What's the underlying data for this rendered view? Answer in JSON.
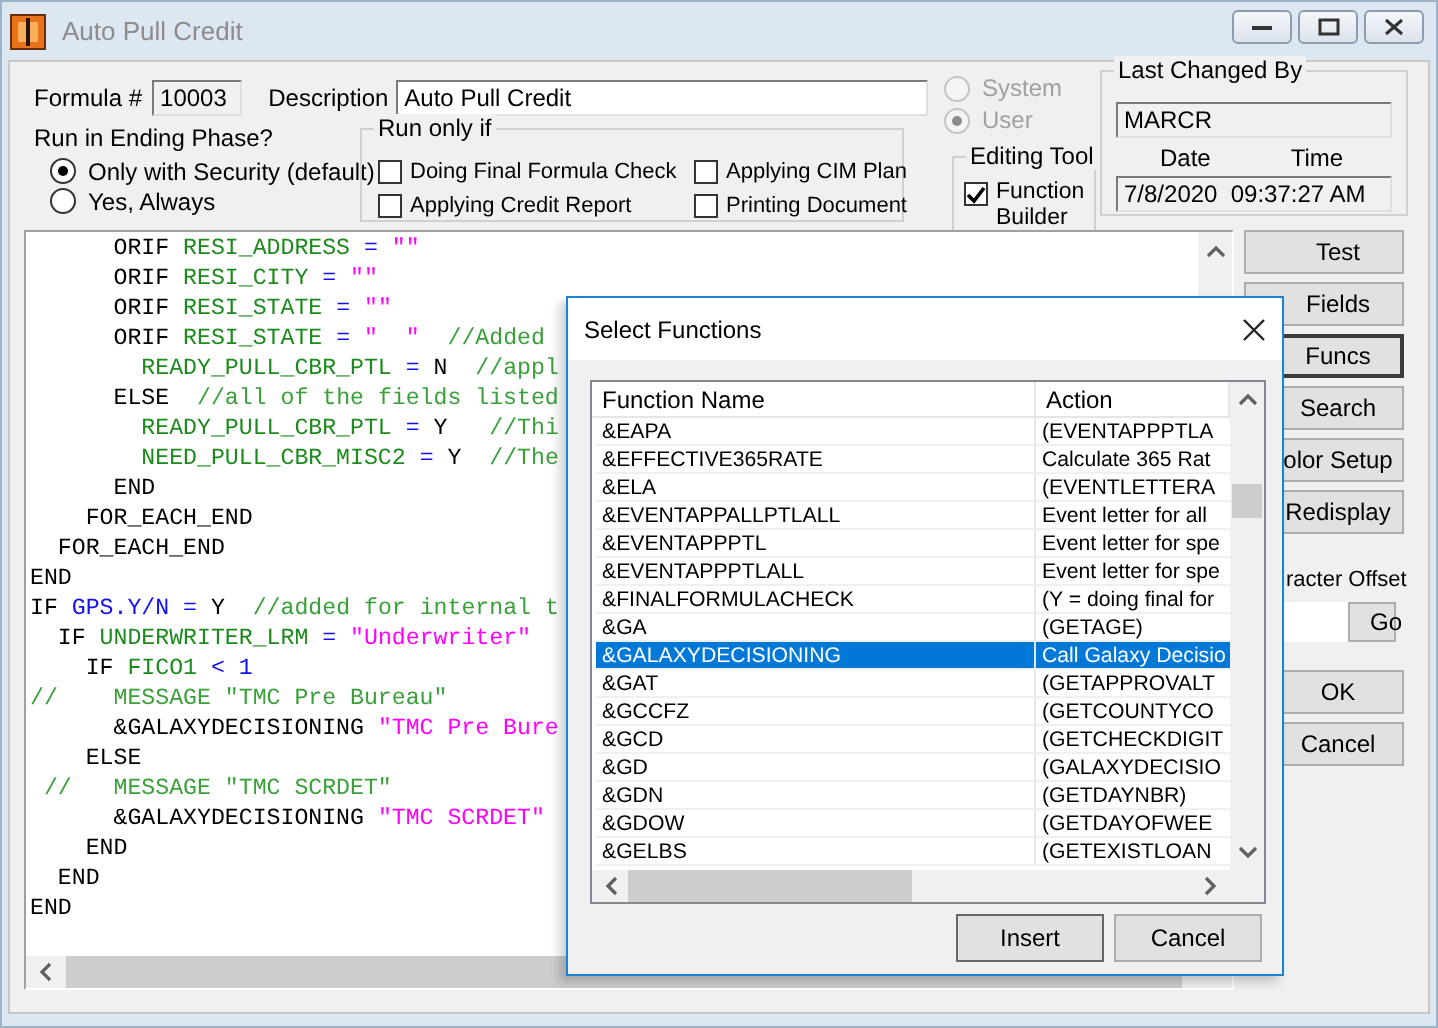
{
  "window": {
    "title": "Auto Pull Credit"
  },
  "formula": {
    "label": "Formula #",
    "value": "10003"
  },
  "description": {
    "label": "Description",
    "value": "Auto Pull Credit"
  },
  "ending_phase": {
    "label": "Run in Ending Phase?",
    "options": [
      {
        "label": "Only with Security (default)",
        "selected": true
      },
      {
        "label": "Yes, Always",
        "selected": false
      }
    ]
  },
  "run_only_if": {
    "title": "Run only if",
    "options": [
      {
        "label": "Doing Final Formula Check",
        "checked": false
      },
      {
        "label": "Applying CIM Plan",
        "checked": false
      },
      {
        "label": "Applying Credit Report",
        "checked": false
      },
      {
        "label": "Printing Document",
        "checked": false
      }
    ]
  },
  "scope": {
    "options": [
      {
        "label": "System",
        "selected": false,
        "disabled": true
      },
      {
        "label": "User",
        "selected": true,
        "disabled": true
      }
    ]
  },
  "editing_tool": {
    "title": "Editing Tool",
    "options": [
      {
        "label": "Function Builder",
        "checked": true
      }
    ]
  },
  "last_changed": {
    "title": "Last Changed By",
    "user": "MARCR",
    "date_label": "Date",
    "time_label": "Time",
    "datetime": "7/8/2020  09:37:27 AM"
  },
  "editor": {
    "lines": [
      {
        "tokens": [
          {
            "kind": "kw",
            "text": "      ORIF "
          },
          {
            "kind": "ident",
            "text": "RESI_ADDRESS"
          },
          {
            "kind": "op",
            "text": " = "
          },
          {
            "kind": "str",
            "text": "\"\""
          }
        ]
      },
      {
        "tokens": [
          {
            "kind": "kw",
            "text": "      ORIF "
          },
          {
            "kind": "ident",
            "text": "RESI_CITY"
          },
          {
            "kind": "op",
            "text": " = "
          },
          {
            "kind": "str",
            "text": "\"\""
          }
        ]
      },
      {
        "tokens": [
          {
            "kind": "kw",
            "text": "      ORIF "
          },
          {
            "kind": "ident",
            "text": "RESI_STATE"
          },
          {
            "kind": "op",
            "text": " = "
          },
          {
            "kind": "str",
            "text": "\"\""
          }
        ]
      },
      {
        "tokens": [
          {
            "kind": "kw",
            "text": "      ORIF "
          },
          {
            "kind": "ident",
            "text": "RESI_STATE"
          },
          {
            "kind": "op",
            "text": " = "
          },
          {
            "kind": "str",
            "text": "\"  \""
          },
          {
            "kind": "comment",
            "text": "  //Added"
          }
        ]
      },
      {
        "tokens": [
          {
            "kind": "ident",
            "text": "        READY_PULL_CBR_PTL"
          },
          {
            "kind": "op",
            "text": " = "
          },
          {
            "kind": "kw",
            "text": "N"
          },
          {
            "kind": "comment",
            "text": "  //appl"
          }
        ]
      },
      {
        "tokens": [
          {
            "kind": "kw",
            "text": "      ELSE"
          },
          {
            "kind": "comment",
            "text": "  //all of the fields listed"
          }
        ]
      },
      {
        "tokens": [
          {
            "kind": "ident",
            "text": "        READY_PULL_CBR_PTL"
          },
          {
            "kind": "op",
            "text": " = "
          },
          {
            "kind": "kw",
            "text": "Y"
          },
          {
            "kind": "comment",
            "text": "   //Thi"
          }
        ]
      },
      {
        "tokens": [
          {
            "kind": "ident",
            "text": "        NEED_PULL_CBR_MISC2"
          },
          {
            "kind": "op",
            "text": " = "
          },
          {
            "kind": "kw",
            "text": "Y"
          },
          {
            "kind": "comment",
            "text": "  //The"
          }
        ]
      },
      {
        "tokens": [
          {
            "kind": "kw",
            "text": "      END"
          }
        ]
      },
      {
        "tokens": [
          {
            "kind": "kw",
            "text": "    FOR_EACH_END"
          }
        ]
      },
      {
        "tokens": [
          {
            "kind": "kw",
            "text": "  FOR_EACH_END"
          }
        ]
      },
      {
        "tokens": [
          {
            "kind": "kw",
            "text": "END"
          }
        ]
      },
      {
        "tokens": [
          {
            "kind": "kw",
            "text": "IF "
          },
          {
            "kind": "var",
            "text": "GPS.Y/N"
          },
          {
            "kind": "op",
            "text": " = "
          },
          {
            "kind": "kw",
            "text": "Y"
          },
          {
            "kind": "comment",
            "text": "  //added for internal t"
          }
        ]
      },
      {
        "tokens": [
          {
            "kind": "kw",
            "text": "  IF "
          },
          {
            "kind": "ident",
            "text": "UNDERWRITER_LRM"
          },
          {
            "kind": "op",
            "text": " = "
          },
          {
            "kind": "str",
            "text": "\"Underwriter\""
          }
        ]
      },
      {
        "tokens": [
          {
            "kind": "kw",
            "text": "    IF "
          },
          {
            "kind": "ident",
            "text": "FICO1"
          },
          {
            "kind": "op",
            "text": " < "
          },
          {
            "kind": "var",
            "text": "1"
          }
        ]
      },
      {
        "tokens": [
          {
            "kind": "comment",
            "text": "//    MESSAGE \"TMC Pre Bureau\""
          }
        ]
      },
      {
        "tokens": [
          {
            "kind": "kw",
            "text": "      &GALAXYDECISIONING "
          },
          {
            "kind": "str",
            "text": "\"TMC Pre Bure"
          }
        ]
      },
      {
        "tokens": [
          {
            "kind": "kw",
            "text": "    ELSE"
          }
        ]
      },
      {
        "tokens": [
          {
            "kind": "comment",
            "text": " //   MESSAGE \"TMC SCRDET\""
          }
        ]
      },
      {
        "tokens": [
          {
            "kind": "kw",
            "text": "      &GALAXYDECISIONING "
          },
          {
            "kind": "str",
            "text": "\"TMC SCRDET\""
          }
        ]
      },
      {
        "tokens": [
          {
            "kind": "kw",
            "text": "    END"
          }
        ]
      },
      {
        "tokens": [
          {
            "kind": "kw",
            "text": "  END"
          }
        ]
      },
      {
        "tokens": [
          {
            "kind": "kw",
            "text": "END"
          }
        ]
      }
    ]
  },
  "side_buttons": [
    {
      "label": "Test",
      "focused": false
    },
    {
      "label": "Fields",
      "focused": false
    },
    {
      "label": "Funcs",
      "focused": true
    },
    {
      "label": "Search",
      "focused": false
    },
    {
      "label": "olor Setup",
      "focused": false
    },
    {
      "label": "Redisplay",
      "focused": false
    }
  ],
  "offset": {
    "label": "racter Offset",
    "button": "Go"
  },
  "dialog_buttons": [
    "OK",
    "Cancel"
  ],
  "select_dialog": {
    "title": "Select Functions",
    "columns": [
      "Function Name",
      "Action"
    ],
    "rows": [
      {
        "name": "&EAPA",
        "action": "(EVENTAPPPTLA",
        "selected": false
      },
      {
        "name": "&EFFECTIVE365RATE",
        "action": "Calculate 365 Rat",
        "selected": false
      },
      {
        "name": "&ELA",
        "action": "(EVENTLETTERA",
        "selected": false
      },
      {
        "name": "&EVENTAPPALLPTLALL",
        "action": "Event letter for all",
        "selected": false
      },
      {
        "name": "&EVENTAPPPTL",
        "action": "Event letter for spe",
        "selected": false
      },
      {
        "name": "&EVENTAPPPTLALL",
        "action": "Event letter for spe",
        "selected": false
      },
      {
        "name": "&FINALFORMULACHECK",
        "action": "(Y = doing final for",
        "selected": false
      },
      {
        "name": "&GA",
        "action": "(GETAGE)",
        "selected": false
      },
      {
        "name": "&GALAXYDECISIONING",
        "action": "Call Galaxy Decisio",
        "selected": true
      },
      {
        "name": "&GAT",
        "action": "(GETAPPROVALT",
        "selected": false
      },
      {
        "name": "&GCCFZ",
        "action": "(GETCOUNTYCO",
        "selected": false
      },
      {
        "name": "&GCD",
        "action": "(GETCHECKDIGIT",
        "selected": false
      },
      {
        "name": "&GD",
        "action": "(GALAXYDECISIO",
        "selected": false
      },
      {
        "name": "&GDN",
        "action": "(GETDAYNBR)",
        "selected": false
      },
      {
        "name": "&GDOW",
        "action": "(GETDAYOFWEE",
        "selected": false
      },
      {
        "name": "&GELBS",
        "action": "(GETEXISTLOAN",
        "selected": false
      }
    ],
    "buttons": [
      "Insert",
      "Cancel"
    ]
  }
}
